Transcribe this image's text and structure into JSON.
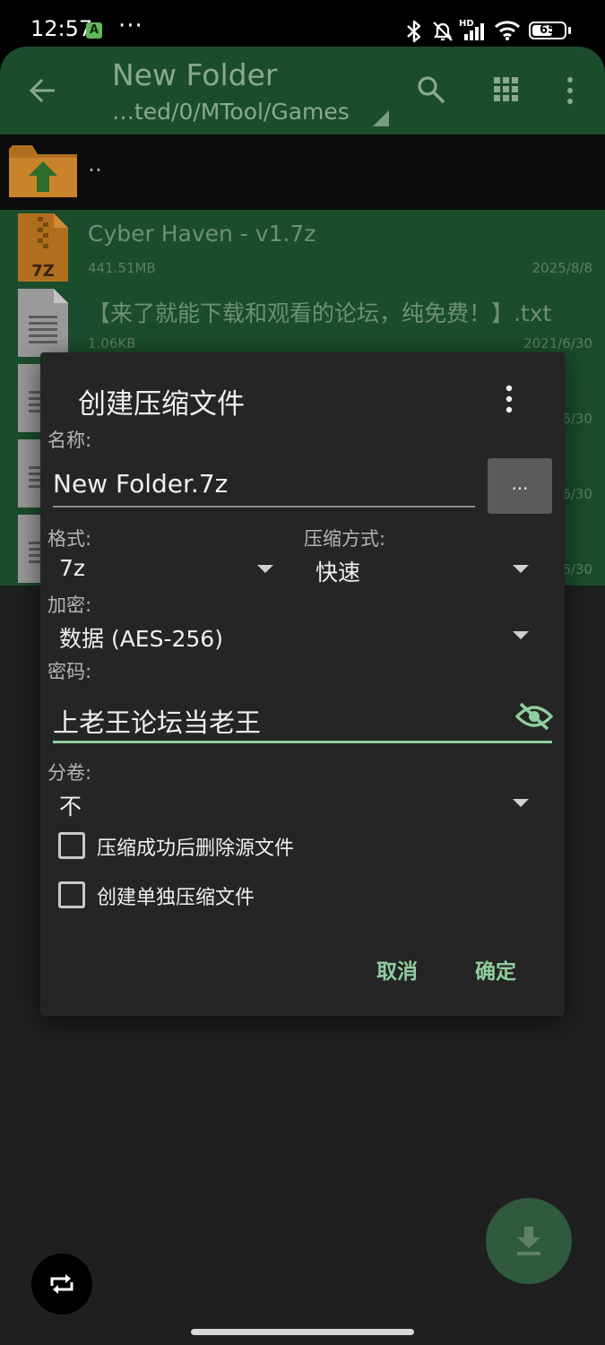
{
  "status_bar": {
    "time": "12:57",
    "app_badge": "A",
    "more": "···",
    "network_label": "HD",
    "battery": "65"
  },
  "toolbar": {
    "title": "New Folder",
    "path": "…ted/0/MTool/Games"
  },
  "files": [
    {
      "name": "..",
      "type": "parent-folder"
    },
    {
      "name": "Cyber Haven - v1.7z",
      "size": "441.51MB",
      "date": "2025/8/8",
      "icon_text": "7Z"
    },
    {
      "name": "【来了就能下载和观看的论坛，纯免费！】.txt",
      "size": "1.06KB",
      "date": "2021/6/30"
    },
    {
      "date": "6/30"
    },
    {
      "date": "6/30"
    },
    {
      "date": "6/30"
    }
  ],
  "dialog": {
    "title": "创建压缩文件",
    "name_label": "名称:",
    "name_value": "New Folder.7z",
    "browse_label": "...",
    "format_label": "格式:",
    "format_value": "7z",
    "method_label": "压缩方式:",
    "method_value": "快速",
    "encryption_label": "加密:",
    "encryption_value": "数据 (AES-256)",
    "password_label": "密码:",
    "password_value": "上老王论坛当老王",
    "split_label": "分卷:",
    "split_value": "不",
    "delete_source_label": "压缩成功后删除源文件",
    "separate_archives_label": "创建单独压缩文件",
    "cancel_label": "取消",
    "ok_label": "确定"
  },
  "colors": {
    "toolbar_bg": "#1b4d2c",
    "dialog_bg": "#252525",
    "accent": "#8fce9e",
    "fab_bg": "#2f5a3c"
  }
}
